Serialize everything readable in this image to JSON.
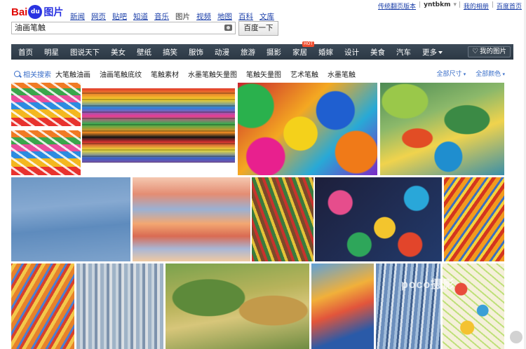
{
  "header": {
    "logo_bai": "Bai",
    "logo_du": "du",
    "logo_pic": "图片",
    "nav": [
      "新闻",
      "网页",
      "贴吧",
      "知道",
      "音乐",
      "图片",
      "视频",
      "地图",
      "百科",
      "文库"
    ],
    "active_nav": "图片",
    "user_links": {
      "classic": "传统翻页版本",
      "user": "yntbkm",
      "my_album": "我的相册",
      "home": "百度首页"
    },
    "search_value": "油画笔触",
    "search_button": "百度一下"
  },
  "categories": {
    "items": [
      "首页",
      "明星",
      "图说天下",
      "美女",
      "壁纸",
      "搞笑",
      "服饰",
      "动漫",
      "旅游",
      "摄影",
      "家居",
      "婚嫁",
      "设计",
      "美食",
      "汽车",
      "更多"
    ],
    "hot_badge": "HOT",
    "my_pics": "我的图片"
  },
  "related": {
    "label": "相关搜索",
    "items": [
      "大笔触油画",
      "油画笔触底纹",
      "笔触素材",
      "水墨笔触矢量图",
      "笔触矢量图",
      "艺术笔触",
      "水墨笔触"
    ],
    "filters": [
      "全部尺寸",
      "全部颜色"
    ]
  },
  "watermark": "poco摄影"
}
